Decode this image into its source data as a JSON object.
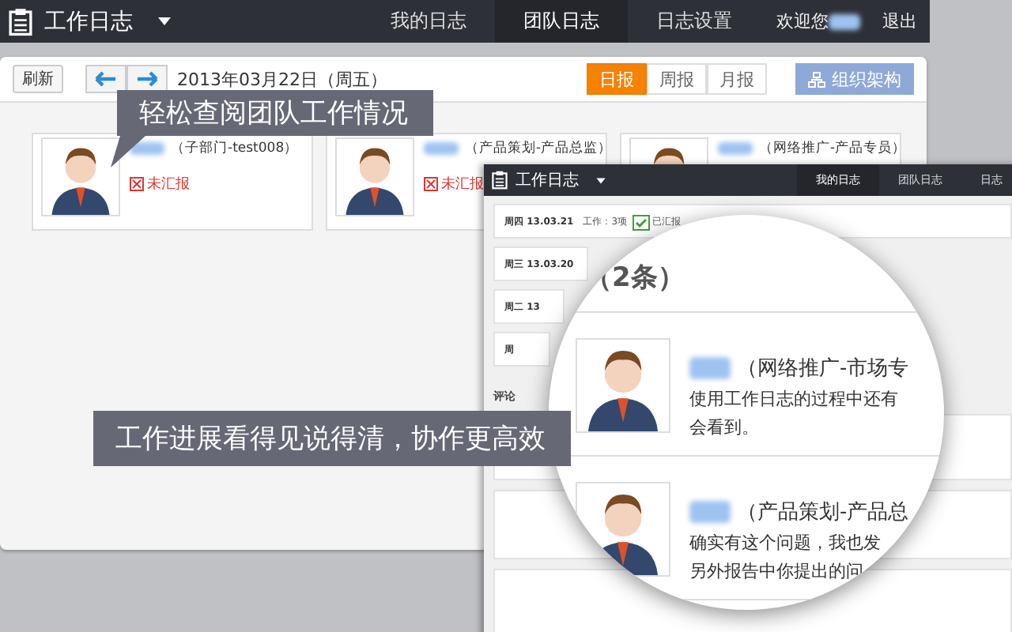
{
  "top_bar": {
    "title": "工作日志",
    "nav": [
      {
        "label": "我的日志",
        "selected": false
      },
      {
        "label": "团队日志",
        "selected": true
      },
      {
        "label": "日志设置",
        "selected": false
      }
    ],
    "welcome": "欢迎您",
    "logout": "退出"
  },
  "toolbar": {
    "refresh": "刷新",
    "date": "2013年03月22日（周五）",
    "periods": [
      {
        "label": "日报",
        "selected": true
      },
      {
        "label": "周报",
        "selected": false
      },
      {
        "label": "月报",
        "selected": false
      }
    ],
    "org_button": "组织架构"
  },
  "members": [
    {
      "dept": "（子部门-test008）",
      "status": "未汇报"
    },
    {
      "dept": "（产品策划-产品总监）",
      "status": "未汇报"
    },
    {
      "dept": "（网络推广-产品专员）"
    }
  ],
  "front_window": {
    "title": "工作日志",
    "nav": [
      {
        "label": "我的日志",
        "selected": true
      },
      {
        "label": "团队日志",
        "selected": false
      },
      {
        "label": "日志",
        "selected": false
      }
    ],
    "days": [
      {
        "label": "周四 13.03.21",
        "summary": "工作：3项",
        "reported": true,
        "reported_label": "已汇报"
      },
      {
        "label": "周三 13.03.20",
        "reported": false
      },
      {
        "label": "周二 13",
        "reported": false
      },
      {
        "label": "周",
        "reported": false
      }
    ],
    "comment_label": "评论"
  },
  "magnifier": {
    "heading": "（2条）",
    "comments": [
      {
        "dept": "（网络推广-市场专",
        "lines": [
          "使用工作日志的过程中还有",
          "会看到。"
        ]
      },
      {
        "dept": "（产品策划-产品总",
        "lines": [
          "确实有这个问题，我也发",
          "另外报告中你提出的问"
        ]
      }
    ]
  },
  "callouts": [
    "轻松查阅团队工作情况",
    "工作进展看得见说得清，协作更高效"
  ]
}
